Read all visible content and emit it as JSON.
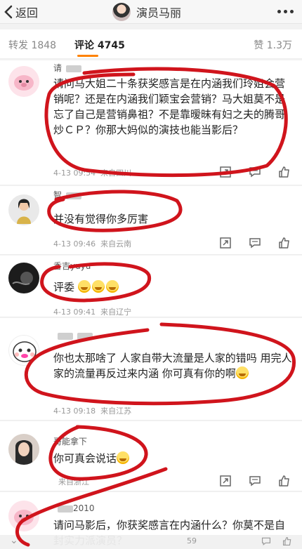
{
  "nav": {
    "back_label": "返回",
    "title": "演员马丽"
  },
  "tabs": [
    {
      "label": "转发 1848"
    },
    {
      "label": "评论 4745"
    },
    {
      "label": "赞 1.3万"
    }
  ],
  "comments": [
    {
      "name": "请",
      "text": "请问马大姐二十条获奖感言是在内涵我们玲姐会营销呢？还是在内涵我们颖宝会营销？马大姐莫不是忘了自己是营销鼻祖？不是靠暧昧有妇之夫的腾哥炒ＣＰ？你那大妈似的演技也能当影后？",
      "time": "4-13 09:54",
      "source": "来自四川"
    },
    {
      "name": "智",
      "text": "并没有觉得你多厉害",
      "time": "4-13 09:46",
      "source": "来自云南"
    },
    {
      "name": "香吉yuyu",
      "text": "评委",
      "time": "4-13 09:41",
      "source": "来自辽宁"
    },
    {
      "name": "",
      "text": "你也太那啥了 人家自带大流量是人家的错吗 用完人家的流量再反过来内涵 你可真有你的啊",
      "time": "4-13 09:18",
      "source": "来自江苏"
    },
    {
      "name": "哥能拿下",
      "text": "你可真会说话",
      "time": "",
      "source": "来自浙江"
    },
    {
      "name": "2010",
      "text": "请问马影后，你获奖感言在内涵什么？你莫不是自封实力派演员？",
      "time": "",
      "source": ""
    }
  ],
  "bottom": {
    "count": "59"
  },
  "colors": {
    "accent": "#ff8200",
    "annotation": "#d0141c"
  },
  "icons": [
    "back-chevron-icon",
    "more-icon",
    "forward-icon",
    "comment-icon",
    "like-icon",
    "laugh-emoji-icon"
  ]
}
